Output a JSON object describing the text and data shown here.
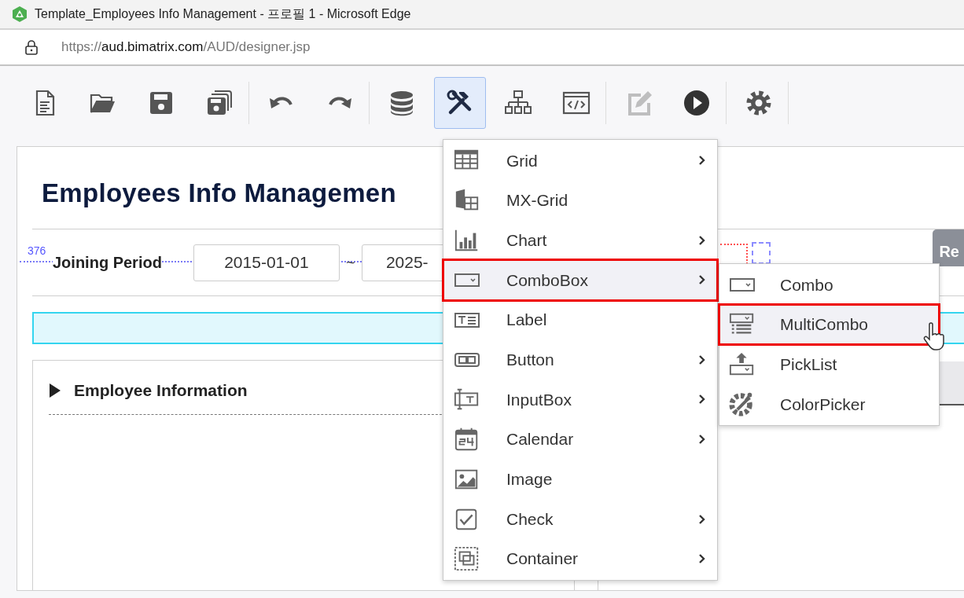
{
  "window": {
    "title": "Template_Employees Info Management - 프로필 1 - Microsoft Edge"
  },
  "address_bar": {
    "scheme": "https://",
    "host": "aud.bimatrix.com",
    "path": "/AUD/designer.jsp"
  },
  "toolbar_groups": [
    {
      "buttons": [
        {
          "kind": "new",
          "selected": false,
          "disabled": false
        },
        {
          "kind": "open",
          "selected": false,
          "disabled": false
        },
        {
          "kind": "save",
          "selected": false,
          "disabled": false
        },
        {
          "kind": "saveall",
          "selected": false,
          "disabled": false
        }
      ]
    },
    {
      "buttons": [
        {
          "kind": "undo",
          "selected": false,
          "disabled": false
        },
        {
          "kind": "redo",
          "selected": false,
          "disabled": false
        }
      ]
    },
    {
      "buttons": [
        {
          "kind": "database",
          "selected": false,
          "disabled": false
        },
        {
          "kind": "tools",
          "selected": true,
          "disabled": false
        },
        {
          "kind": "hierarchy",
          "selected": false,
          "disabled": false
        },
        {
          "kind": "code",
          "selected": false,
          "disabled": false
        }
      ]
    },
    {
      "buttons": [
        {
          "kind": "edit",
          "selected": false,
          "disabled": true
        },
        {
          "kind": "run",
          "selected": false,
          "disabled": false
        }
      ]
    },
    {
      "buttons": [
        {
          "kind": "settings",
          "selected": false,
          "disabled": false
        }
      ]
    }
  ],
  "canvas": {
    "title": "Employees Info Managemen",
    "guide_label": "376",
    "filter_label": "Joining Period",
    "date_from": "2015-01-01",
    "separator": "~",
    "date_to": "2025-",
    "button": "Re",
    "section_title": "Employee Information"
  },
  "menu": [
    {
      "kind": "grid",
      "label": "Grid",
      "submenu": true,
      "selected": false
    },
    {
      "kind": "mxgrid",
      "label": "MX-Grid",
      "submenu": false,
      "selected": false
    },
    {
      "kind": "chart",
      "label": "Chart",
      "submenu": true,
      "selected": false
    },
    {
      "kind": "combo",
      "label": "ComboBox",
      "submenu": true,
      "selected": true
    },
    {
      "kind": "label",
      "label": "Label",
      "submenu": false,
      "selected": false
    },
    {
      "kind": "button",
      "label": "Button",
      "submenu": true,
      "selected": false
    },
    {
      "kind": "input",
      "label": "InputBox",
      "submenu": true,
      "selected": false
    },
    {
      "kind": "calendar",
      "label": "Calendar",
      "submenu": true,
      "selected": false
    },
    {
      "kind": "image",
      "label": "Image",
      "submenu": false,
      "selected": false
    },
    {
      "kind": "check",
      "label": "Check",
      "submenu": true,
      "selected": false
    },
    {
      "kind": "container",
      "label": "Container",
      "submenu": true,
      "selected": false
    }
  ],
  "submenu": [
    {
      "kind": "combo",
      "label": "Combo",
      "selected": false
    },
    {
      "kind": "multicombo",
      "label": "MultiCombo",
      "selected": true
    },
    {
      "kind": "picklist",
      "label": "PickList",
      "selected": false
    },
    {
      "kind": "colorpicker",
      "label": "ColorPicker",
      "selected": false
    }
  ]
}
